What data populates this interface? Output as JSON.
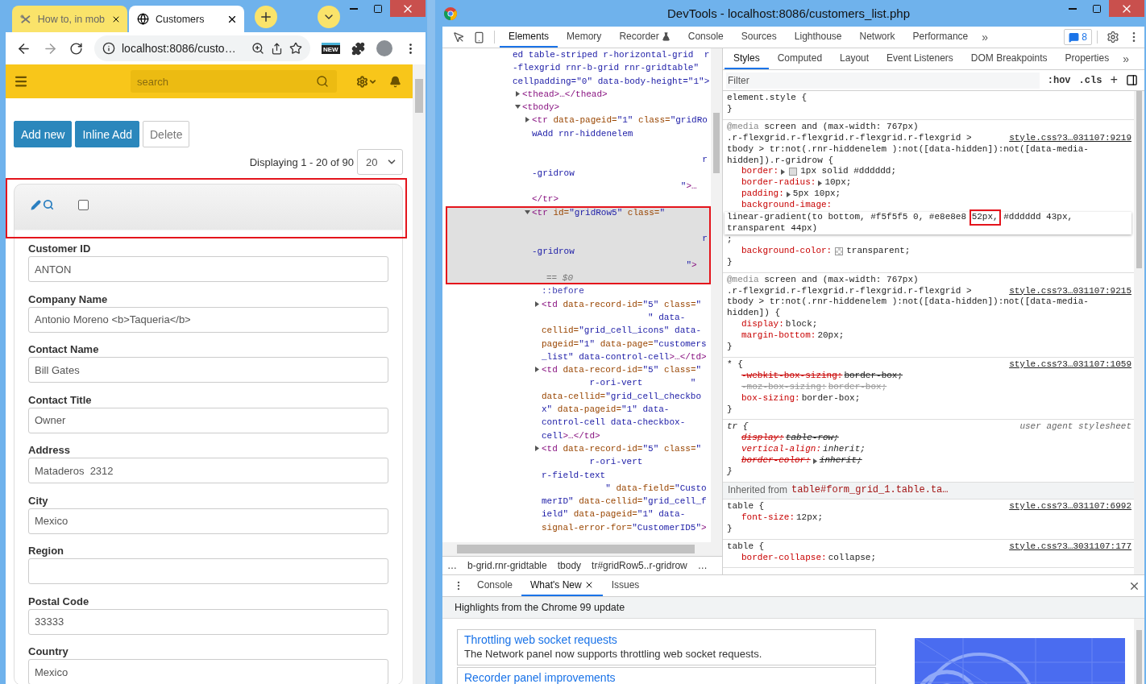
{
  "browser": {
    "tabs": [
      {
        "title": "How to, in mob",
        "selected": false
      },
      {
        "title": "Customers",
        "selected": true
      }
    ],
    "address": "localhost:8086/custo…",
    "extension_label": "NEW"
  },
  "app": {
    "search_placeholder": "search",
    "buttons": [
      {
        "label": "Add new",
        "kind": "primary"
      },
      {
        "label": "Inline Add",
        "kind": "primary"
      },
      {
        "label": "Delete",
        "kind": "plain"
      }
    ],
    "paging_info": "Displaying 1 - 20 of 90",
    "page_size": "20",
    "row": {
      "checked": false,
      "fields": [
        {
          "label": "Customer ID",
          "value": "ANTON"
        },
        {
          "label": "Company Name",
          "value": "Antonio Moreno <b>Taqueria</b>"
        },
        {
          "label": "Contact Name",
          "value": "Bill Gates"
        },
        {
          "label": "Contact Title",
          "value": "Owner"
        },
        {
          "label": "Address",
          "value": "Mataderos  2312"
        },
        {
          "label": "City",
          "value": "Mexico"
        },
        {
          "label": "Region"
        },
        {
          "label": "Postal Code",
          "value": "33333"
        },
        {
          "label": "Country",
          "value": "Mexico"
        }
      ]
    }
  },
  "devtools": {
    "title": "DevTools - localhost:8086/customers_list.php",
    "tabs": [
      {
        "label": "Elements",
        "selected": true,
        "experimental": false
      },
      {
        "label": "Memory",
        "selected": false,
        "experimental": false
      },
      {
        "label": "Recorder",
        "selected": false,
        "experimental": true
      },
      {
        "label": "Console",
        "selected": false,
        "experimental": false
      },
      {
        "label": "Sources",
        "selected": false,
        "experimental": false
      },
      {
        "label": "Lighthouse",
        "selected": false,
        "experimental": false
      },
      {
        "label": "Network",
        "selected": false,
        "experimental": false
      },
      {
        "label": "Performance",
        "selected": false,
        "experimental": false
      }
    ],
    "more": "»",
    "issues_count": "8",
    "dom": {
      "kind": "element",
      "text": "ed table-striped r-horizontal-grid  r\n-flexgrid rnr-b-grid rnr-gridtable\"\ncellpadding=\"0\" data-body-height=\"1\">",
      "selected": false,
      "children": [
        {
          "kind": "element",
          "text": "<thead>…</thead>",
          "expanded": false,
          "selected": false
        },
        {
          "kind": "element",
          "text": "<tbody>",
          "expanded": true,
          "selected": false,
          "children": [
            {
              "kind": "element",
              "text": "<tr data-pageid=\"1\" class=\"gridRo\nwAdd rnr-hiddenelem\n\n                                r\n-gridrow\n                            \">…",
              "close": "</tr>",
              "expanded": false,
              "selected": false
            },
            {
              "kind": "element",
              "text": "<tr id=\"gridRow5\" class=\"\n\n                                r\n-gridrow\n                             \">",
              "console_ref": "== $0",
              "expanded": true,
              "selected": true,
              "children": [
                {
                  "kind": "pseudo",
                  "text": "::before",
                  "selected": false
                },
                {
                  "kind": "element",
                  "text": "<td data-record-id=\"5\" class=\"\n                    \" data-\ncellid=\"grid_cell_icons\" data-\npageid=\"1\" data-page=\"customers\n_list\" data-control-cell>…</td>",
                  "expanded": false,
                  "selected": false
                },
                {
                  "kind": "element",
                  "text": "<td data-record-id=\"5\" class=\"\n         r-ori-vert         \"\ndata-cellid=\"grid_cell_checkbo\nx\" data-pageid=\"1\" data-\ncontrol-cell data-checkbox-\ncell>…</td>",
                  "expanded": false,
                  "selected": false
                },
                {
                  "kind": "element",
                  "text": "<td data-record-id=\"5\" class=\"\n         r-ori-vert\nr-field-text\n            \" data-field=\"Custo\nmerID\" data-cellid=\"grid_cell_f\nield\" data-pageid=\"1\" data-\nsignal-error-for=\"CustomerID5\">",
                  "expanded": false,
                  "selected": false
                }
              ]
            }
          ]
        }
      ]
    },
    "breadcrumbs": [
      "…",
      "b-grid.rnr-gridtable",
      "tbody",
      "tr#gridRow5..r-gridrow",
      "…"
    ],
    "styles_tabs": [
      {
        "label": "Styles",
        "selected": true
      },
      {
        "label": "Computed",
        "selected": false
      },
      {
        "label": "Layout",
        "selected": false
      },
      {
        "label": "Event Listeners",
        "selected": false
      },
      {
        "label": "DOM Breakpoints",
        "selected": false
      },
      {
        "label": "Properties",
        "selected": false
      }
    ],
    "styles_more": "»",
    "filter_placeholder": "Filter",
    "hov": ":hov",
    "cls": ".cls",
    "add": "+",
    "rules": [
      {
        "kind": "rule",
        "selector": [
          "element.style {"
        ],
        "user_agent": false,
        "close": "}"
      },
      {
        "kind": "rule",
        "media": "@media screen and (max-width: 767px)",
        "selector": [
          ".r-flexgrid.r-flexgrid.r-flexgrid.r-flexgrid >",
          "tbody > tr:not(.rnr-hiddenelem ):not([data-hidden]):not([data-media-",
          "hidden]).r-gridrow {"
        ],
        "source": "style.css?3…031107:9219",
        "user_agent": false,
        "props": [
          {
            "name": "border:",
            "value": "1px solid #dddddd;",
            "expandable": true,
            "swatch": true,
            "struck": false,
            "inactive": false
          },
          {
            "name": "border-radius:",
            "value": "10px;",
            "expandable": true,
            "struck": false,
            "inactive": false
          },
          {
            "name": "padding:",
            "value": "5px 10px;",
            "expandable": true,
            "struck": false,
            "inactive": false
          },
          {
            "name": "background-image:",
            "editor": [
              {
                "text": "linear-gradient(to bottom, #f5f5f5 0, #e8e8e8 ",
                "highlighted": false
              },
              {
                "text": "52px,",
                "highlighted": true
              },
              {
                "text": " #dddddd 43px,",
                "highlighted": false
              },
              {
                "text": "transparent 44px)",
                "highlighted": false
              }
            ],
            "value": ";",
            "expandable": false,
            "struck": false,
            "inactive": false
          },
          {
            "name": "background-color:",
            "value": "transparent;",
            "expandable": false,
            "swatch": true,
            "struck": false,
            "inactive": false
          }
        ],
        "close": "}"
      },
      {
        "kind": "rule",
        "media": "@media screen and (max-width: 767px)",
        "selector": [
          ".r-flexgrid.r-flexgrid.r-flexgrid.r-flexgrid >",
          "tbody > tr:not(.rnr-hiddenelem ):not([data-hidden]):not([data-media-",
          "hidden]) {"
        ],
        "source": "style.css?3…031107:9215",
        "user_agent": false,
        "props": [
          {
            "name": "display:",
            "value": "block;",
            "expandable": false,
            "struck": false,
            "inactive": false
          },
          {
            "name": "margin-bottom:",
            "value": "20px;",
            "expandable": false,
            "struck": false,
            "inactive": false
          }
        ],
        "close": "}"
      },
      {
        "kind": "rule",
        "selector": [
          "* {"
        ],
        "source": "style.css?3…031107:1059",
        "user_agent": false,
        "props": [
          {
            "name": "-webkit-box-sizing:",
            "value": "border-box;",
            "expandable": false,
            "struck": true,
            "inactive": false
          },
          {
            "name": "-moz-box-sizing:",
            "value": "border-box;",
            "expandable": false,
            "struck": true,
            "inactive": true
          },
          {
            "name": "box-sizing:",
            "value": "border-box;",
            "expandable": false,
            "struck": false,
            "inactive": false
          }
        ],
        "close": "}"
      },
      {
        "kind": "rule",
        "selector": [
          "tr {"
        ],
        "source": "user agent stylesheet",
        "user_agent": true,
        "props": [
          {
            "name": "display:",
            "value": "table-row;",
            "expandable": false,
            "struck": true,
            "inactive": false
          },
          {
            "name": "vertical-align:",
            "value": "inherit;",
            "expandable": false,
            "struck": false,
            "inactive": false
          },
          {
            "name": "border-color:",
            "value": "inherit;",
            "expandable": true,
            "struck": true,
            "inactive": false
          }
        ],
        "close": "}"
      },
      {
        "kind": "inherited",
        "label": "Inherited from",
        "target": "table#form_grid_1.table.ta…"
      },
      {
        "kind": "rule",
        "selector": [
          "table {"
        ],
        "source": "style.css?3…031107:6992",
        "user_agent": false,
        "props": [
          {
            "name": "font-size:",
            "value": "12px;",
            "expandable": false,
            "struck": false,
            "inactive": false
          }
        ],
        "close": "}"
      },
      {
        "kind": "rule",
        "selector": [
          "table {"
        ],
        "source": "style.css?3…3031107:177",
        "user_agent": false,
        "props": [
          {
            "name": "border-collapse:",
            "value": "collapse;",
            "expandable": false,
            "struck": false,
            "inactive": false
          }
        ]
      }
    ],
    "drawer": {
      "tabs": [
        {
          "label": "Console",
          "selected": false,
          "closable": false
        },
        {
          "label": "What's New",
          "selected": true,
          "closable": true
        },
        {
          "label": "Issues",
          "selected": false,
          "closable": false
        }
      ],
      "heading": "Highlights from the Chrome 99 update",
      "cards": [
        {
          "title": "Throttling web socket requests",
          "text": "The Network panel now supports throttling web socket requests."
        },
        {
          "title": "Recorder panel improvements"
        }
      ]
    }
  }
}
